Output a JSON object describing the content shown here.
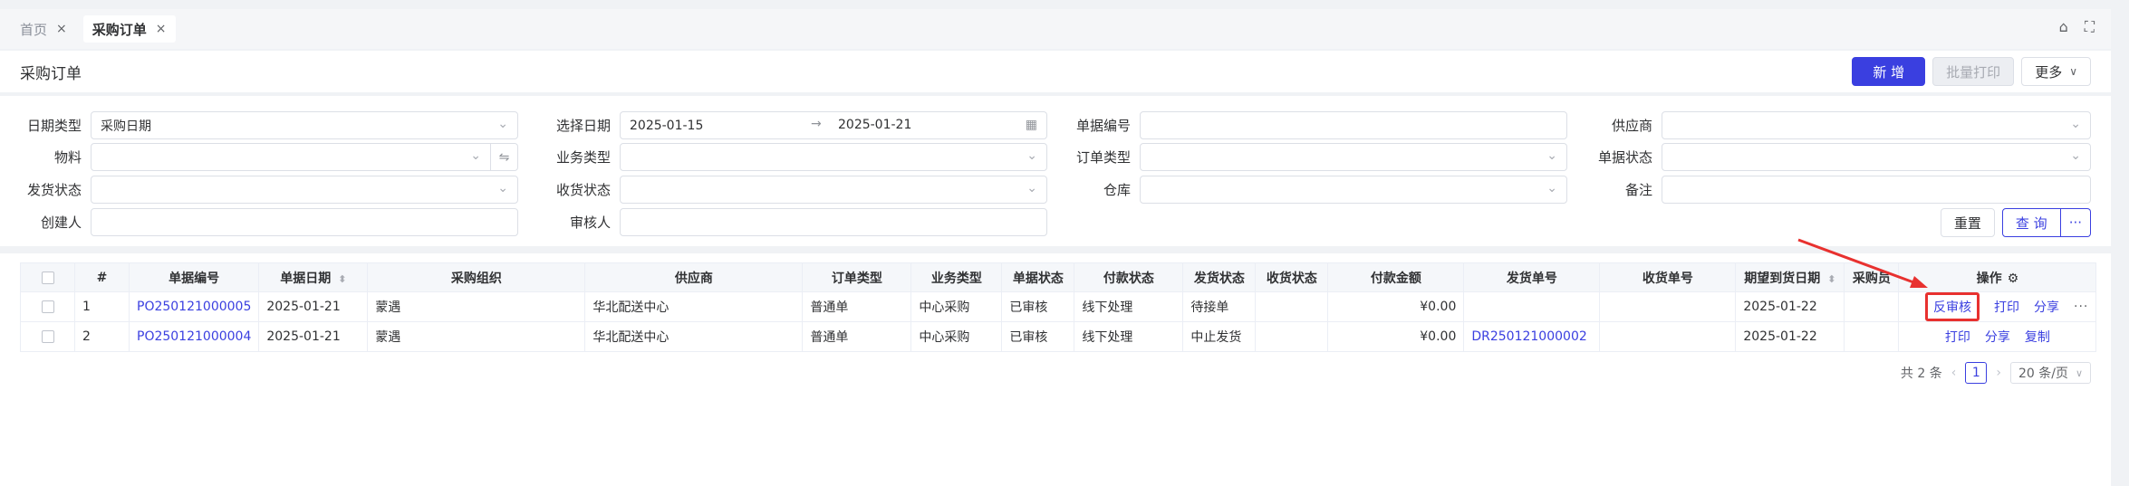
{
  "tabs": [
    {
      "label": "首页",
      "close": "×"
    },
    {
      "label": "采购订单",
      "close": "×"
    }
  ],
  "header": {
    "title": "采购订单",
    "new_label": "新 增",
    "batch_print_label": "批量打印",
    "more_label": "更多",
    "more_chevron": "∨"
  },
  "filters": {
    "date_type_label": "日期类型",
    "date_type_value": "采购日期",
    "select_date_label": "选择日期",
    "date_start": "2025-01-15",
    "date_end": "2025-01-21",
    "doc_no_label": "单据编号",
    "supplier_label": "供应商",
    "material_label": "物料",
    "biz_type_label": "业务类型",
    "order_type_label": "订单类型",
    "doc_status_label": "单据状态",
    "ship_status_label": "发货状态",
    "recv_status_label": "收货状态",
    "warehouse_label": "仓库",
    "remark_label": "备注",
    "creator_label": "创建人",
    "reviewer_label": "审核人",
    "reset_label": "重置",
    "query_label": "查 询",
    "query_more": "···"
  },
  "table": {
    "headers": {
      "index": "#",
      "doc_no": "单据编号",
      "doc_date": "单据日期",
      "org": "采购组织",
      "supplier": "供应商",
      "order_type": "订单类型",
      "biz_type": "业务类型",
      "doc_status": "单据状态",
      "pay_status": "付款状态",
      "ship_status": "发货状态",
      "recv_status": "收货状态",
      "pay_amount": "付款金额",
      "ship_no": "发货单号",
      "recv_no": "收货单号",
      "expected_date": "期望到货日期",
      "buyer": "采购员",
      "ops": "操作"
    },
    "rows": [
      {
        "index": "1",
        "doc_no": "PO250121000005",
        "doc_date": "2025-01-21",
        "org": "蒙遇",
        "supplier": "华北配送中心",
        "order_type": "普通单",
        "biz_type": "中心采购",
        "doc_status": "已审核",
        "pay_status": "线下处理",
        "ship_status": "待接单",
        "recv_status": "",
        "pay_amount": "¥0.00",
        "ship_no": "",
        "recv_no": "",
        "expected_date": "2025-01-22",
        "buyer": "",
        "ops": [
          "反审核",
          "打印",
          "分享",
          "···"
        ]
      },
      {
        "index": "2",
        "doc_no": "PO250121000004",
        "doc_date": "2025-01-21",
        "org": "蒙遇",
        "supplier": "华北配送中心",
        "order_type": "普通单",
        "biz_type": "中心采购",
        "doc_status": "已审核",
        "pay_status": "线下处理",
        "ship_status": "中止发货",
        "recv_status": "",
        "pay_amount": "¥0.00",
        "ship_no": "DR250121000002",
        "recv_no": "",
        "expected_date": "2025-01-22",
        "buyer": "",
        "ops": [
          "打印",
          "分享",
          "复制"
        ]
      }
    ]
  },
  "pager": {
    "total": "共 2 条",
    "page": "1",
    "size": "20 条/页"
  },
  "colors": {
    "primary": "#3a3fe0",
    "highlight": "#e8312f"
  }
}
